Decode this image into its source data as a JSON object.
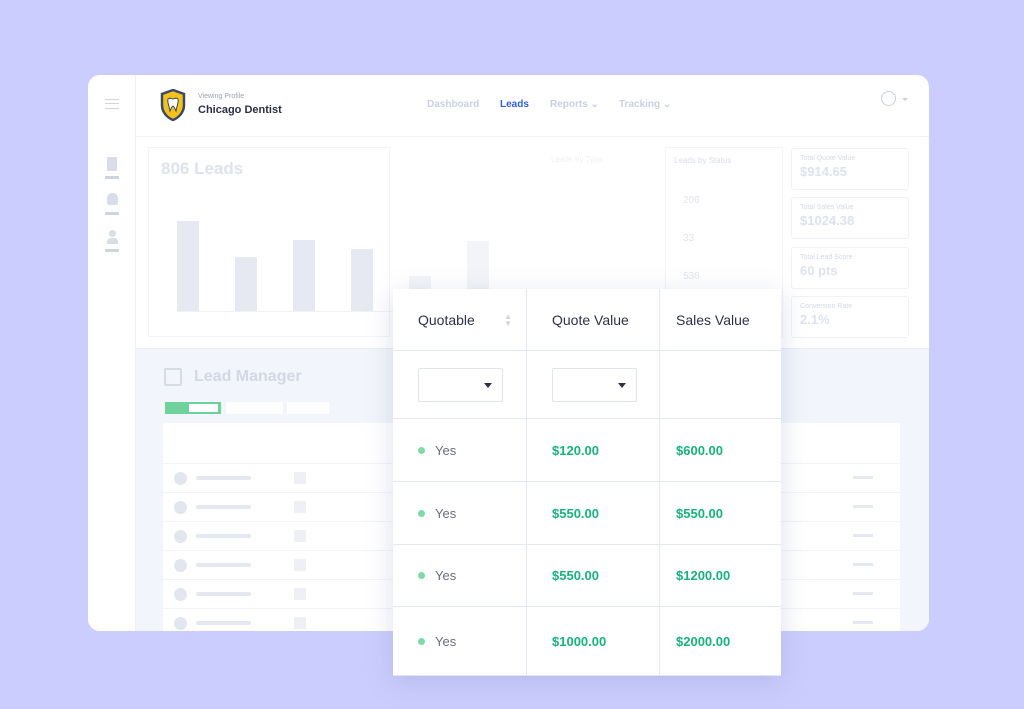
{
  "header": {
    "viewing_label": "Viewing Profile",
    "profile_name": "Chicago Dentist",
    "nav": [
      {
        "label": "Dashboard"
      },
      {
        "label": "Leads",
        "active": true
      },
      {
        "label": "Reports ⌄"
      },
      {
        "label": "Tracking ⌄"
      }
    ]
  },
  "dashboard": {
    "leads_title": "806 Leads",
    "type_title": "Leads by Type",
    "status_title": "Leads by Status",
    "status_counts": [
      "206",
      "33",
      "538"
    ],
    "stats": [
      {
        "label": "Total Quote Value",
        "value": "$914.65"
      },
      {
        "label": "Total Sales Value",
        "value": "$1024.38"
      },
      {
        "label": "Total Lead Score",
        "value": "60 pts"
      },
      {
        "label": "Conversion Rate",
        "value": "2.1%"
      }
    ],
    "bar_levels": [
      0.9,
      0.54,
      0.71,
      0.62,
      0.35,
      0.7
    ]
  },
  "lead_manager": {
    "title": "Lead Manager"
  },
  "table": {
    "columns": [
      "Quotable",
      "Quote Value",
      "Sales Value"
    ],
    "rows": [
      {
        "quotable": "Yes",
        "quote": "$120.00",
        "sales": "$600.00"
      },
      {
        "quotable": "Yes",
        "quote": "$550.00",
        "sales": "$550.00"
      },
      {
        "quotable": "Yes",
        "quote": "$550.00",
        "sales": "$1200.00"
      },
      {
        "quotable": "Yes",
        "quote": "$1000.00",
        "sales": "$2000.00"
      }
    ]
  },
  "colors": {
    "background": "#cbcdfe",
    "active_nav": "#2f5fd8",
    "money": "#16b37a",
    "yes_dot": "#7ddba8"
  }
}
